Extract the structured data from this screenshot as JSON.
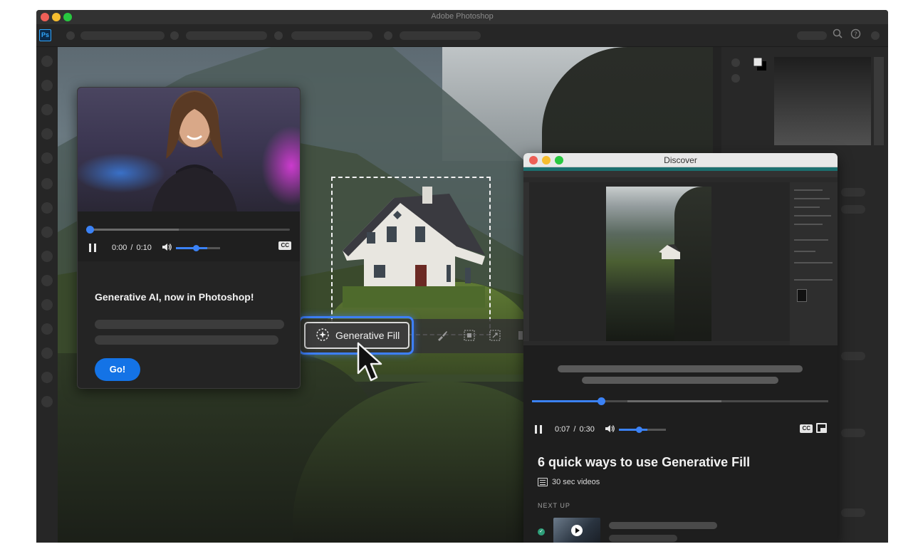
{
  "window": {
    "title": "Adobe Photoshop",
    "app_logo": "Ps"
  },
  "header_icons": [
    "search-icon",
    "help-icon"
  ],
  "context_bar": {
    "primary_label": "Generative Fill",
    "icons": [
      "generate-sparkle-icon",
      "brush-icon",
      "mask-icon",
      "transform-icon"
    ]
  },
  "video_card": {
    "time_current": "0:00",
    "time_separator": "/",
    "time_total": "0:10",
    "progress": 0,
    "volume": 0.55,
    "cc_label": "CC",
    "title": "Generative AI, now in Photoshop!",
    "cta_label": "Go!"
  },
  "discover": {
    "window_title": "Discover",
    "time_current": "0:07",
    "time_separator": "/",
    "time_total": "0:30",
    "progress": 0.2333,
    "volume": 0.6,
    "cc_label": "CC",
    "title": "6 quick ways to use Generative Fill",
    "subtitle": "30 sec videos",
    "next_up_label": "NEXT UP"
  },
  "colors": {
    "accent_blue": "#1473e6",
    "selection_glow": "#3d7ffb",
    "panel_bg": "#242424",
    "app_bg": "#2b2b2b"
  }
}
